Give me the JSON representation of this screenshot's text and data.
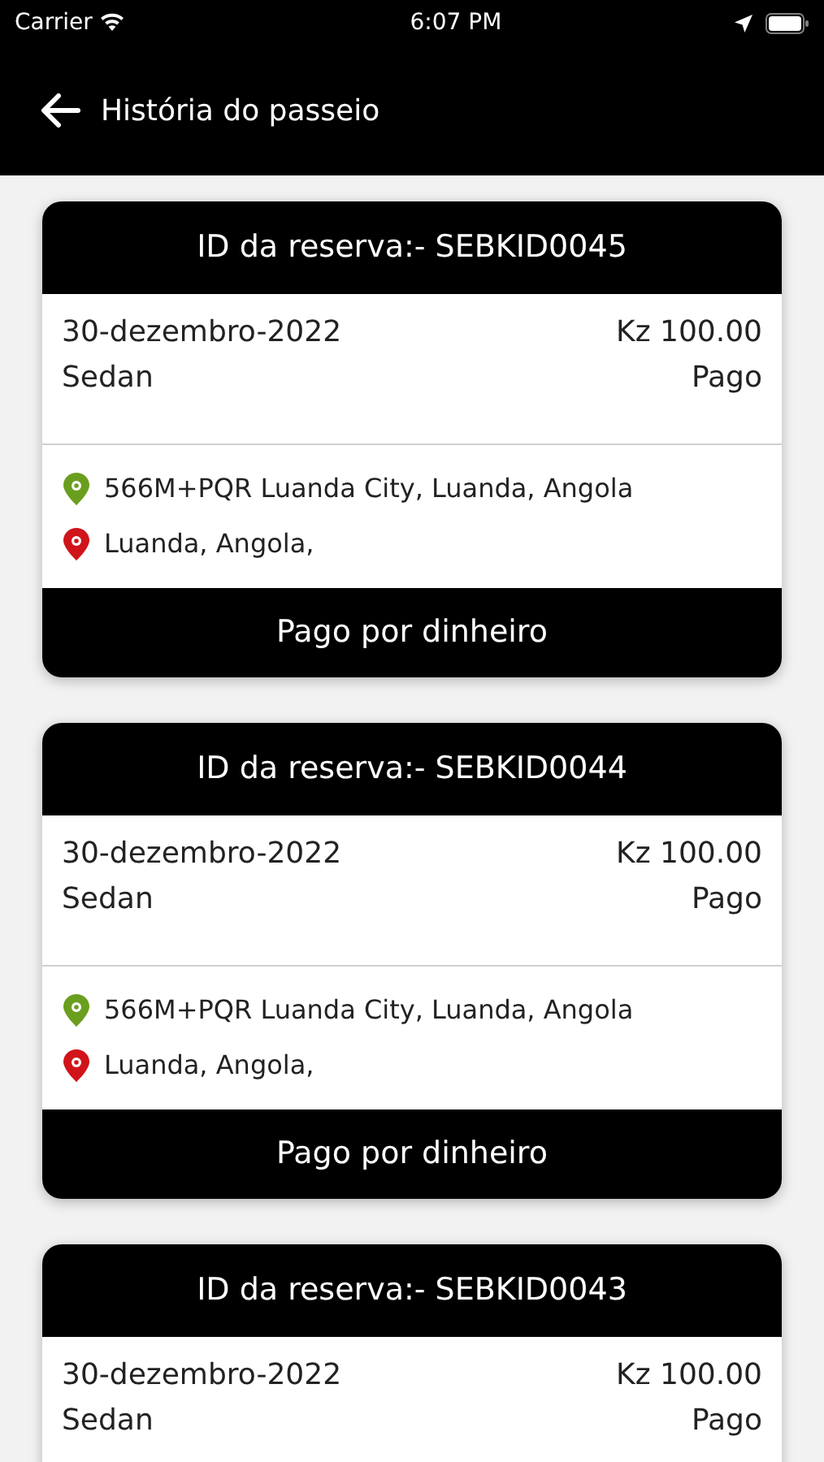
{
  "status_bar": {
    "carrier": "Carrier",
    "time": "6:07 PM"
  },
  "header": {
    "title": "História do passeio"
  },
  "bookings": [
    {
      "booking_id": "ID da reserva:- SEBKID0045",
      "date": "30-dezembro-2022",
      "price": "Kz 100.00",
      "vehicle": "Sedan",
      "status": "Pago",
      "pickup": "566M+PQR Luanda City, Luanda, Angola",
      "dropoff": "Luanda, Angola,",
      "payment": "Pago por dinheiro"
    },
    {
      "booking_id": "ID da reserva:- SEBKID0044",
      "date": "30-dezembro-2022",
      "price": "Kz 100.00",
      "vehicle": "Sedan",
      "status": "Pago",
      "pickup": "566M+PQR Luanda City, Luanda, Angola",
      "dropoff": "Luanda, Angola,",
      "payment": "Pago por dinheiro"
    },
    {
      "booking_id": "ID da reserva:- SEBKID0043",
      "date": "30-dezembro-2022",
      "price": "Kz 100.00",
      "vehicle": "Sedan",
      "status": "Pago"
    }
  ]
}
